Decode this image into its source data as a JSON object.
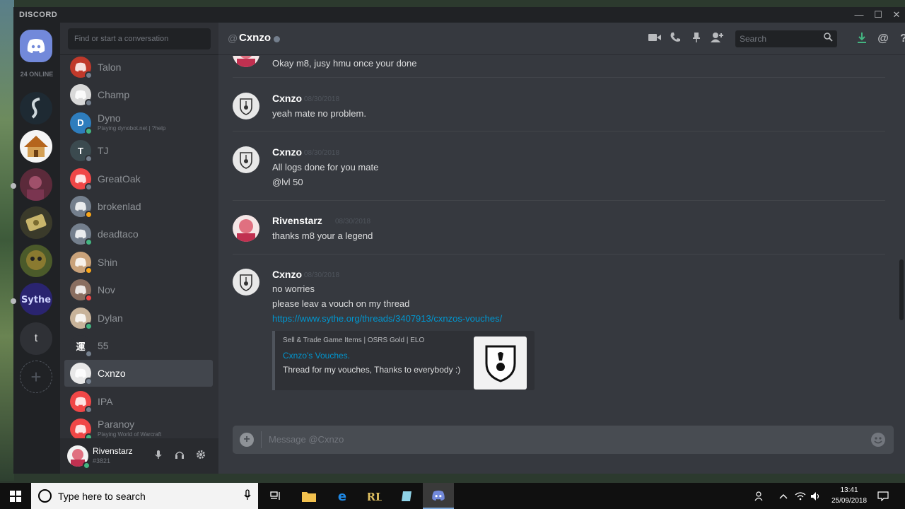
{
  "window": {
    "brand": "DISCORD",
    "minimize": "—",
    "maximize": "☐",
    "close": "✕"
  },
  "guilds": {
    "online_count": "24 ONLINE",
    "text_guild_letter": "t",
    "add": "+"
  },
  "dm_search_placeholder": "Find or start a conversation",
  "dms": [
    {
      "name": "Talon",
      "sub": "",
      "status": "off",
      "color": "#c0392b",
      "letter": ""
    },
    {
      "name": "Champ",
      "sub": "",
      "status": "off",
      "color": "#d9d9d9",
      "letter": ""
    },
    {
      "name": "Dyno",
      "sub": "Playing dynobot.net | ?help",
      "status": "online",
      "color": "#2e7dbd",
      "letter": "D"
    },
    {
      "name": "TJ",
      "sub": "",
      "status": "off",
      "color": "#3b4a4f",
      "letter": "T"
    },
    {
      "name": "GreatOak",
      "sub": "",
      "status": "off",
      "color": "#f04747",
      "letter": ""
    },
    {
      "name": "brokenlad",
      "sub": "",
      "status": "idle",
      "color": "#747f8d",
      "letter": ""
    },
    {
      "name": "deadtaco",
      "sub": "",
      "status": "online",
      "color": "#747f8d",
      "letter": ""
    },
    {
      "name": "Shin",
      "sub": "",
      "status": "idle",
      "color": "#c9a27a",
      "letter": ""
    },
    {
      "name": "Nov",
      "sub": "",
      "status": "dnd",
      "color": "#8a6e60",
      "letter": ""
    },
    {
      "name": "Dylan",
      "sub": "",
      "status": "online",
      "color": "#c8b39a",
      "letter": ""
    },
    {
      "name": "55",
      "sub": "",
      "status": "off",
      "color": "#2f3136",
      "letter": "運"
    },
    {
      "name": "Cxnzo",
      "sub": "",
      "status": "off",
      "color": "#e8e8e8",
      "letter": ""
    },
    {
      "name": "IPA",
      "sub": "",
      "status": "off",
      "color": "#f04747",
      "letter": ""
    },
    {
      "name": "Paranoy",
      "sub": "Playing World of Warcraft",
      "status": "online",
      "color": "#f04747",
      "letter": ""
    }
  ],
  "user": {
    "name": "Rivenstarz",
    "tag": "#3821"
  },
  "chat": {
    "at": "@",
    "channel_name": "Cxnzo",
    "search_placeholder": "Search",
    "composer_placeholder": "Message @Cxnzo",
    "first_line": "Okay m8, jusy hmu once your done",
    "messages": [
      {
        "author": "Cxnzo",
        "time": "08/30/2018",
        "lines": [
          "yeah mate no problem."
        ]
      },
      {
        "author": "Cxnzo",
        "time": "08/30/2018",
        "lines": [
          "All logs done for you mate",
          "@lvl 50"
        ]
      },
      {
        "author": "Rivenstarz",
        "time": "08/30/2018",
        "lines": [
          "thanks m8 your a legend"
        ]
      },
      {
        "author": "Cxnzo",
        "time": "08/30/2018",
        "lines": [
          "no worries",
          "please leav a vouch on my thread"
        ],
        "link": "https://www.sythe.org/threads/3407913/cxnzos-vouches/"
      }
    ],
    "embed": {
      "provider": "Sell & Trade Game Items | OSRS Gold | ELO",
      "title": "Cxnzo's Vouches.",
      "description": "Thread for my vouches, Thanks to everybody :)"
    }
  },
  "taskbar": {
    "search_text": "Type here to search",
    "time": "13:41",
    "date": "25/09/2018"
  },
  "colors": {
    "accent": "#7289da",
    "link": "#0096cf",
    "online": "#43b581",
    "idle": "#faa61a",
    "dnd": "#f04747"
  }
}
